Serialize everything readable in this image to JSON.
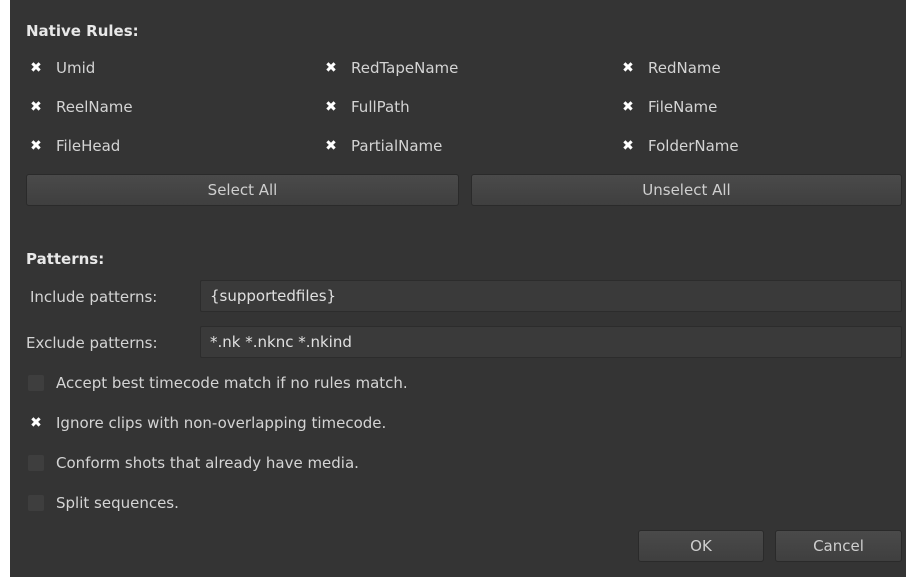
{
  "native_rules": {
    "title": "Native Rules:",
    "rules": [
      {
        "label": "Umid",
        "checked": true
      },
      {
        "label": "RedTapeName",
        "checked": true
      },
      {
        "label": "RedName",
        "checked": true
      },
      {
        "label": "ReelName",
        "checked": true
      },
      {
        "label": "FullPath",
        "checked": true
      },
      {
        "label": "FileName",
        "checked": true
      },
      {
        "label": "FileHead",
        "checked": true
      },
      {
        "label": "PartialName",
        "checked": true
      },
      {
        "label": "FolderName",
        "checked": true
      }
    ],
    "select_all_label": "Select All",
    "unselect_all_label": "Unselect All"
  },
  "patterns": {
    "title": "Patterns:",
    "include_label": "Include patterns:",
    "include_value": "{supportedfiles}",
    "exclude_label": "Exclude patterns:",
    "exclude_value": "*.nk *.nknc *.nkind"
  },
  "options": [
    {
      "label": "Accept best timecode match if no rules match.",
      "checked": false
    },
    {
      "label": "Ignore clips with non-overlapping timecode.",
      "checked": true
    },
    {
      "label": "Conform shots that already have media.",
      "checked": false
    },
    {
      "label": "Split sequences.",
      "checked": false
    }
  ],
  "footer": {
    "ok_label": "OK",
    "cancel_label": "Cancel"
  },
  "check_glyph": "✖"
}
